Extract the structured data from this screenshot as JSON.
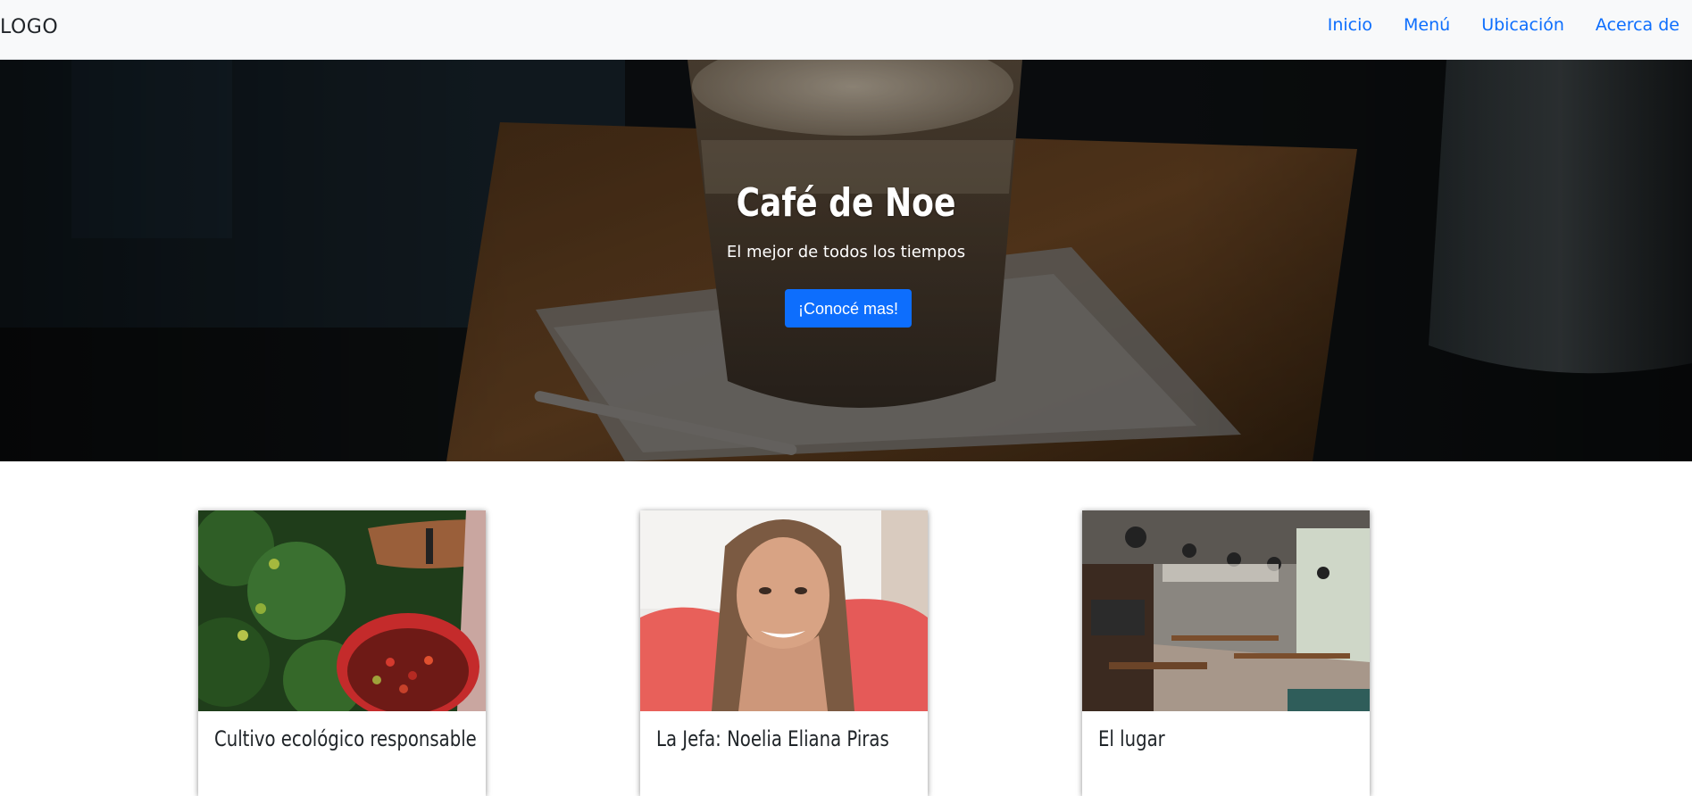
{
  "navbar": {
    "logo": "LOGO",
    "links": [
      "Inicio",
      "Menú",
      "Ubicación",
      "Acerca de"
    ]
  },
  "hero": {
    "title": "Café de Noe",
    "subtitle": "El mejor de todos los tiempos",
    "button_label": "¡Conocé mas!"
  },
  "cards": [
    {
      "title": "Cultivo ecológico responsable",
      "image": "coffee-harvest-photo"
    },
    {
      "title": "La Jefa: Noelia Eliana Piras",
      "image": "portrait-photo"
    },
    {
      "title": "El lugar",
      "image": "cafe-interior-photo"
    }
  ],
  "colors": {
    "accent": "#0d6efd",
    "navbar_bg": "#f8f9fa",
    "text_dark": "#212529"
  }
}
